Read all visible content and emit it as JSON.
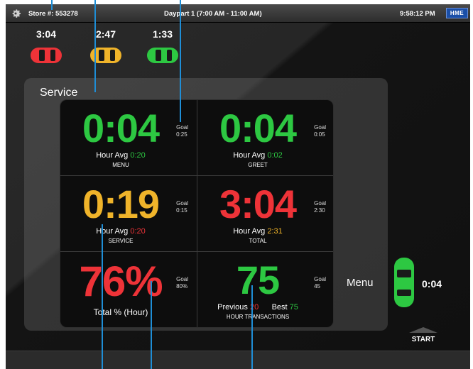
{
  "topbar": {
    "store": "Store #: 553278",
    "daypart": "Daypart 1 (7:00 AM - 11:00 AM)",
    "clock": "9:58:12 PM",
    "brand": "HME"
  },
  "lane": [
    {
      "time": "3:04",
      "color": "#ee3338"
    },
    {
      "time": "2:47",
      "color": "#f0b42a"
    },
    {
      "time": "1:33",
      "color": "#2dc842"
    }
  ],
  "service": {
    "title": "Service",
    "tiles": [
      {
        "value": "0:04",
        "goal_label": "Goal",
        "goal": "0:25",
        "avg_label": "Hour Avg",
        "avg": "0:20",
        "label": "MENU"
      },
      {
        "value": "0:04",
        "goal_label": "Goal",
        "goal": "0:05",
        "avg_label": "Hour Avg",
        "avg": "0:02",
        "label": "GREET"
      },
      {
        "value": "0:19",
        "goal_label": "Goal",
        "goal": "0:15",
        "avg_label": "Hour Avg",
        "avg": "0:20",
        "label": "SERVICE"
      },
      {
        "value": "3:04",
        "goal_label": "Goal",
        "goal": "2:30",
        "avg_label": "Hour Avg",
        "avg": "2:31",
        "label": "TOTAL"
      },
      {
        "value": "76%",
        "goal_label": "Goal",
        "goal": "80%",
        "label": "Total % (Hour)"
      },
      {
        "value": "75",
        "goal_label": "Goal",
        "goal": "45",
        "prev_label": "Previous",
        "prev": "20",
        "best_label": "Best",
        "best": "75",
        "label": "HOUR TRANSACTIONS"
      }
    ]
  },
  "menu_lane": {
    "label": "Menu",
    "time": "0:04"
  },
  "start_label": "START",
  "colors": {
    "green": "#2dc842",
    "yellow": "#f0b42a",
    "red": "#ee3338",
    "callout": "#1f8ed6"
  }
}
